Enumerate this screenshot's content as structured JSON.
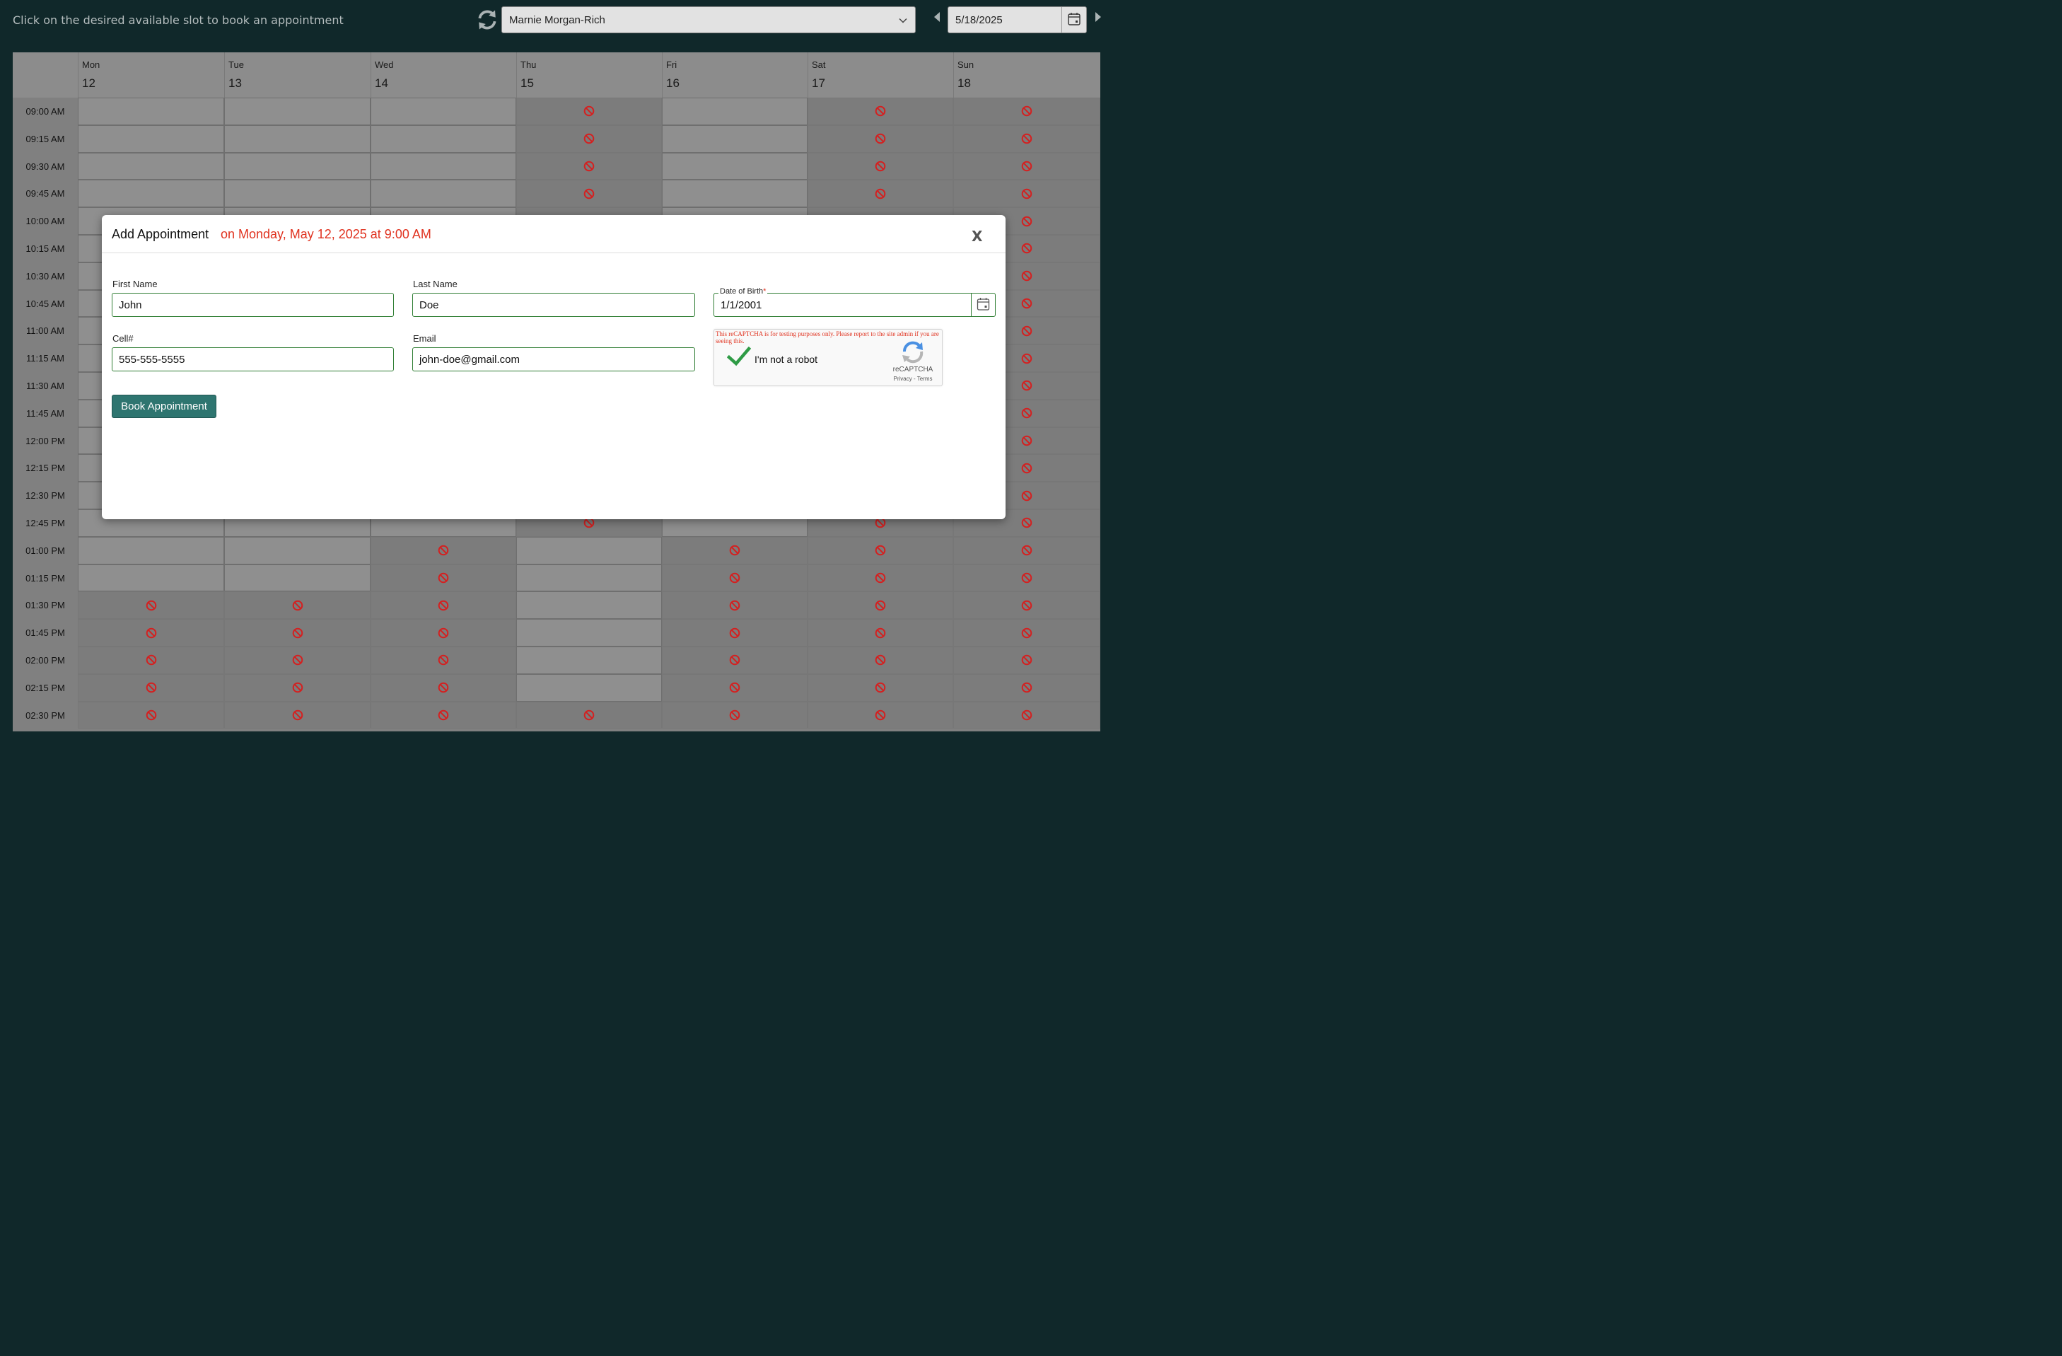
{
  "header": {
    "instruction": "Click on the desired available slot to book an appointment",
    "provider_select": "Marnie Morgan-Rich",
    "date_value": "5/18/2025"
  },
  "calendar": {
    "days": [
      {
        "name": "Mon",
        "date": "12"
      },
      {
        "name": "Tue",
        "date": "13"
      },
      {
        "name": "Wed",
        "date": "14"
      },
      {
        "name": "Thu",
        "date": "15"
      },
      {
        "name": "Fri",
        "date": "16"
      },
      {
        "name": "Sat",
        "date": "17"
      },
      {
        "name": "Sun",
        "date": "18"
      }
    ],
    "times": [
      "09:00 AM",
      "09:15 AM",
      "09:30 AM",
      "09:45 AM",
      "10:00 AM",
      "10:15 AM",
      "10:30 AM",
      "10:45 AM",
      "11:00 AM",
      "11:15 AM",
      "11:30 AM",
      "11:45 AM",
      "12:00 PM",
      "12:15 PM",
      "12:30 PM",
      "12:45 PM",
      "01:00 PM",
      "01:15 PM",
      "01:30 PM",
      "01:45 PM",
      "02:00 PM",
      "02:15 PM",
      "02:30 PM"
    ],
    "slot_rows": [
      "OOOXOXX",
      "OOOXOXX",
      "OOOXOXX",
      "OOOXOXX",
      "OOOXOXX",
      "OOOXOXX",
      "OOOXOXX",
      "OOOXOXX",
      "OOOXOXX",
      "OOOXOXX",
      "OOOXOXX",
      "OOOXOXX",
      "OOOXOXX",
      "OOOXOXX",
      "OOOXOXX",
      "OOOXOXX",
      "OOXOXXX",
      "OOXOXXX",
      "XXXOXXX",
      "XXXOXXX",
      "XXXOXXX",
      "XXXOXXX",
      "XXXXXXX"
    ],
    "unavailable_icon": "no-entry-icon"
  },
  "modal": {
    "title": "Add Appointment",
    "subtitle": "on Monday, May 12, 2025 at 9:00 AM",
    "close_label": "X",
    "fields": {
      "first_name": {
        "label": "First Name",
        "value": "John"
      },
      "last_name": {
        "label": "Last Name",
        "value": "Doe"
      },
      "dob": {
        "label": "Date of Birth",
        "required_mark": "*",
        "value": "1/1/2001"
      },
      "cell": {
        "label": "Cell#",
        "value": "555-555-5555"
      },
      "email": {
        "label": "Email",
        "value": "john-doe@gmail.com"
      }
    },
    "recaptcha": {
      "warning": "This reCAPTCHA is for testing purposes only. Please report to the site admin if you are seeing this.",
      "label": "I'm not a robot",
      "brand": "reCAPTCHA",
      "links": "Privacy - Terms"
    },
    "book_button": "Book Appointment"
  },
  "colors": {
    "background": "#10282a",
    "accent": "#2e7570",
    "highlight": "#e0321f",
    "field_border": "#2e7d32"
  }
}
